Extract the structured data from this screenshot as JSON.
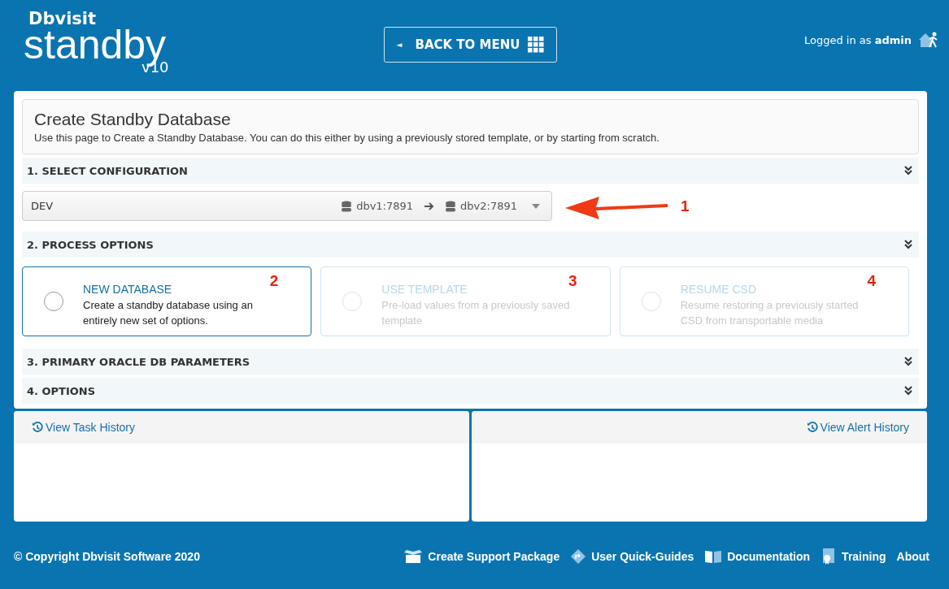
{
  "header": {
    "logo": {
      "brand": "Dbvisit",
      "product": "standby",
      "version": "v10"
    },
    "back_button": "BACK TO MENU",
    "back_caret": "◄",
    "login": {
      "prefix": "Logged in as",
      "user": "admin"
    }
  },
  "page": {
    "title": "Create Standby Database",
    "description": "Use this page to Create a Standby Database. You can do this either by using a previously stored template, or by starting from scratch."
  },
  "sections": [
    {
      "kind": "config",
      "title": "1. SELECT CONFIGURATION",
      "config": {
        "name": "DEV",
        "source": "dbv1:7891",
        "target": "dbv2:7891"
      },
      "annotation": "1"
    },
    {
      "kind": "options",
      "title": "2. PROCESS OPTIONS",
      "options": [
        {
          "title": "NEW DATABASE",
          "text": "Create a standby database using an entirely new set of options.",
          "disabled": false,
          "selected": false,
          "annotation": "2"
        },
        {
          "title": "USE TEMPLATE",
          "text": "Pre-load values from a previously saved template",
          "disabled": true,
          "selected": false,
          "annotation": "3"
        },
        {
          "title": "RESUME CSD",
          "text": "Resume restoring a previously started CSD from transportable media",
          "disabled": true,
          "selected": false,
          "annotation": "4"
        }
      ]
    },
    {
      "kind": "plain",
      "title": "3. PRIMARY ORACLE DB PARAMETERS"
    },
    {
      "kind": "plain",
      "title": "4. OPTIONS"
    }
  ],
  "history": [
    "View Task History",
    "View Alert History"
  ],
  "footer": {
    "copyright": "© Copyright Dbvisit Software 2020",
    "links": [
      {
        "kind": "package",
        "label": "Create Support Package"
      },
      {
        "kind": "guide",
        "label": "User Quick-Guides"
      },
      {
        "kind": "docs",
        "label": "Documentation"
      },
      {
        "kind": "training",
        "label": "Training"
      },
      {
        "kind": "none",
        "label": "About"
      }
    ]
  }
}
